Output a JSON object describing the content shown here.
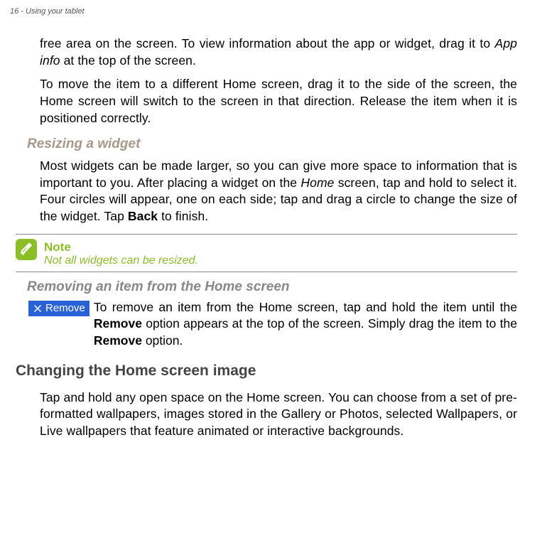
{
  "header": "16 - Using your tablet",
  "para1_part1": "free area on the screen. To view information about the app or widget, drag it to ",
  "para1_italic": "App info",
  "para1_part2": " at the top of the screen.",
  "para2": "To move the item to a different Home screen, drag it to the side of the screen, the Home screen will switch to the screen in that direction. Release the item when it is positioned correctly.",
  "resizing_title": "Resizing a widget",
  "para3_part1": "Most widgets can be made larger, so you can give more space to information that is important to you. After placing a widget on the ",
  "para3_italic": "Home",
  "para3_part2": " screen, tap and hold to select it. Four circles will appear, one on each side; tap and drag a circle to change the size of the widget. Tap ",
  "para3_bold": "Back",
  "para3_part3": " to finish.",
  "note_label": "Note",
  "note_text": "Not all widgets can be resized.",
  "removing_title": "Removing an item from the Home screen",
  "remove_badge": "Remove",
  "para4_part1": "To remove an item from the Home screen, tap and hold the item until the ",
  "para4_bold1": "Remove",
  "para4_part2": " option appears at the top of the screen. Simply drag the item to the ",
  "para4_bold2": "Remove",
  "para4_part3": " option.",
  "changing_title": "Changing the Home screen image",
  "para5": "Tap and hold any open space on the Home screen. You can choose from a set of pre-formatted wallpapers, images stored in the Gallery or Photos, selected Wallpapers, or Live wallpapers that feature animated or interactive backgrounds."
}
